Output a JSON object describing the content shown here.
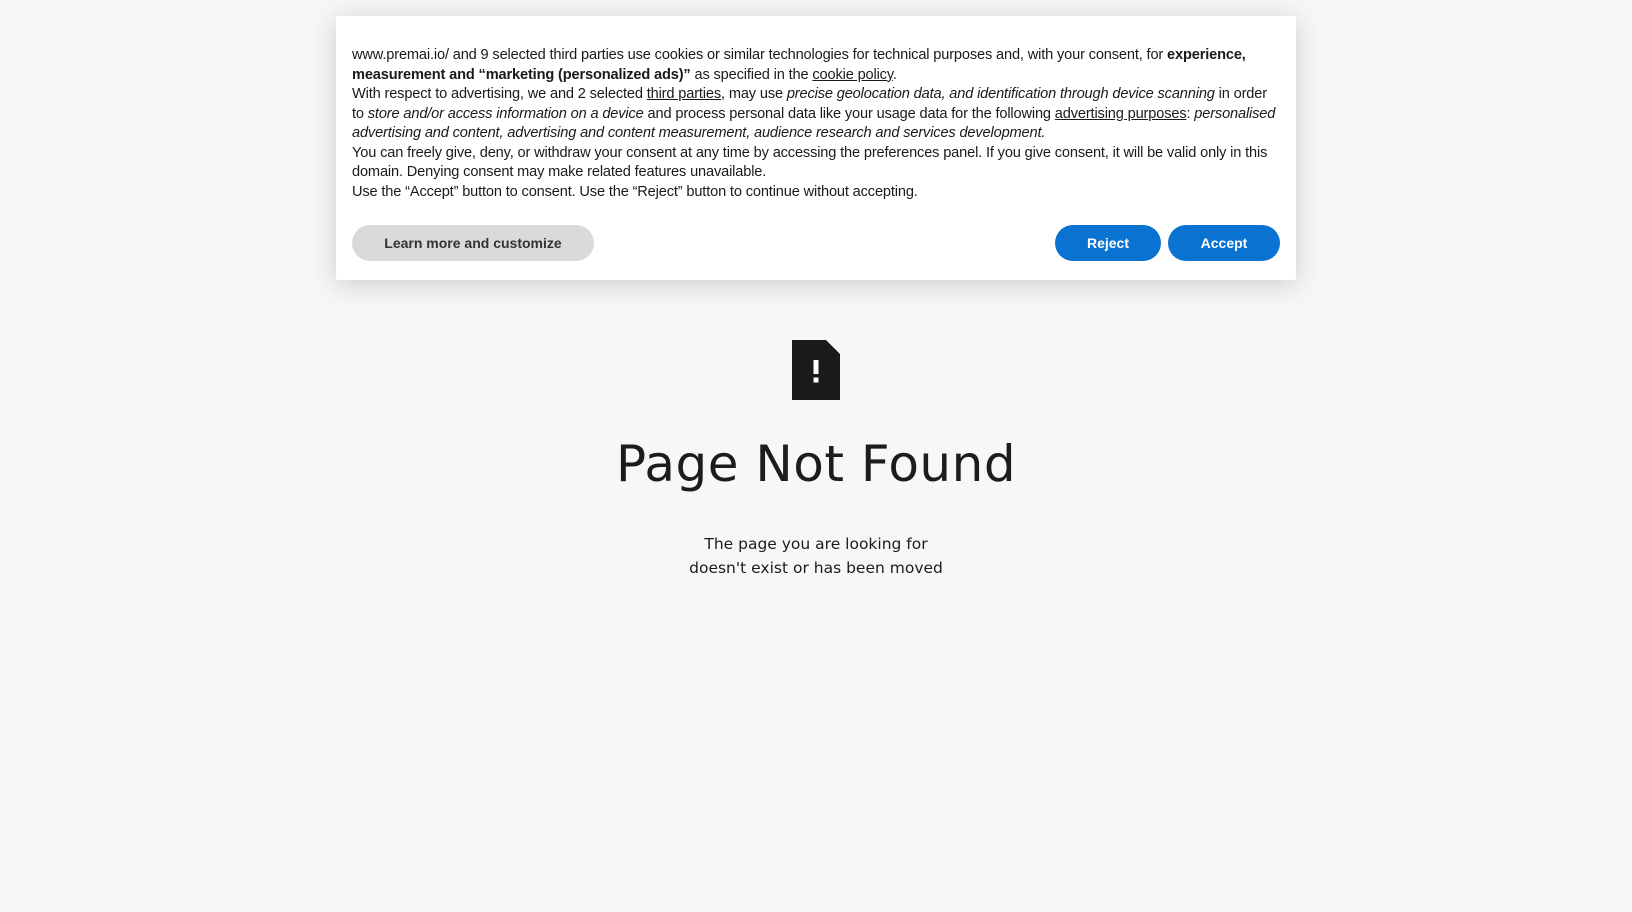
{
  "cookie_banner": {
    "p1": {
      "lead": "www.premai.io/ and 9 selected third parties use cookies or similar technologies for technical purposes and, with your consent, for ",
      "bold": "experience, measurement and “marketing (personalized ads)”",
      "mid": " as specified in the ",
      "link": "cookie policy",
      "end": "."
    },
    "p2": {
      "lead": "With respect to advertising, we and 2 selected ",
      "link1": "third parties",
      "mid1": ", may use ",
      "italic1": "precise geolocation data, and identification through device scanning",
      "mid2": " in order to ",
      "italic2": "store and/or access information on a device",
      "mid3": " and process personal data like your usage data for the following ",
      "link2": "advertising purposes",
      "mid4": ": ",
      "italic3": "personalised advertising and content, advertising and content measurement, audience research and services development."
    },
    "p3": "You can freely give, deny, or withdraw your consent at any time by accessing the preferences panel. If you give consent, it will be valid only in this domain. Denying consent may make related features unavailable.",
    "p4": "Use the “Accept” button to consent. Use the “Reject” button to continue without accepting.",
    "buttons": {
      "customize": "Learn more and customize",
      "reject": "Reject",
      "accept": "Accept"
    },
    "button_color": "#0a72d1"
  },
  "not_found": {
    "icon": "document-alert-icon",
    "title": "Page Not Found",
    "desc_line1": "The page you are looking for",
    "desc_line2": "doesn't exist or has been moved"
  }
}
